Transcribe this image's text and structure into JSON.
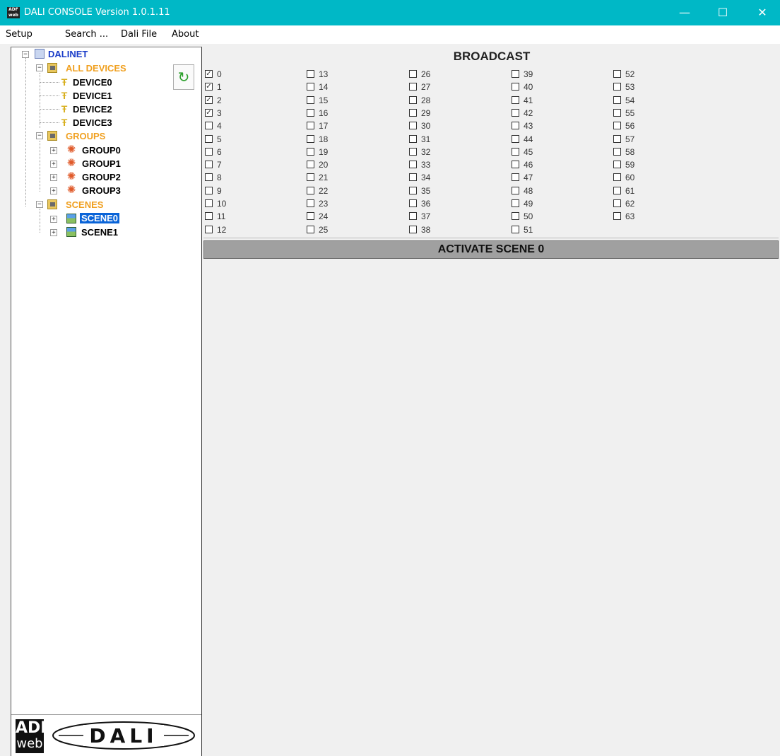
{
  "window": {
    "title": "DALI CONSOLE Version 1.0.1.11",
    "app_icon_text": "ADF web",
    "minimize_glyph": "—",
    "maximize_glyph": "☐",
    "close_glyph": "✕"
  },
  "menu": [
    "Setup",
    "Search ...",
    "Dali File",
    "About"
  ],
  "tree": {
    "root": "DALINET",
    "all_devices": "ALL DEVICES",
    "devices": [
      "DEVICE0",
      "DEVICE1",
      "DEVICE2",
      "DEVICE3"
    ],
    "groups_label": "GROUPS",
    "groups": [
      "GROUP0",
      "GROUP1",
      "GROUP2",
      "GROUP3"
    ],
    "scenes_label": "SCENES",
    "scenes": [
      "SCENE0",
      "SCENE1"
    ],
    "selected": "SCENE0"
  },
  "refresh_icon": "refresh-icon",
  "logo": {
    "adf_top": "ADF",
    "adf_bottom": "web",
    "dali": "DALI"
  },
  "broadcast": {
    "title": "BROADCAST",
    "addresses": [
      "0",
      "1",
      "2",
      "3",
      "4",
      "5",
      "6",
      "7",
      "8",
      "9",
      "10",
      "11",
      "12",
      "13",
      "14",
      "15",
      "16",
      "17",
      "18",
      "19",
      "20",
      "21",
      "22",
      "23",
      "24",
      "25",
      "26",
      "27",
      "28",
      "29",
      "30",
      "31",
      "32",
      "33",
      "34",
      "35",
      "36",
      "37",
      "38",
      "39",
      "40",
      "41",
      "42",
      "43",
      "44",
      "45",
      "46",
      "47",
      "48",
      "49",
      "50",
      "51",
      "52",
      "53",
      "54",
      "55",
      "56",
      "57",
      "58",
      "59",
      "60",
      "61",
      "62",
      "63"
    ],
    "checked": [
      0,
      1,
      2,
      3
    ]
  },
  "activate_button": "ACTIVATE SCENE 0",
  "colors": {
    "titlebar": "#00b8c6",
    "folder_label": "#f0a020",
    "root_label": "#1a3cc8",
    "selection": "#0a64d8"
  }
}
